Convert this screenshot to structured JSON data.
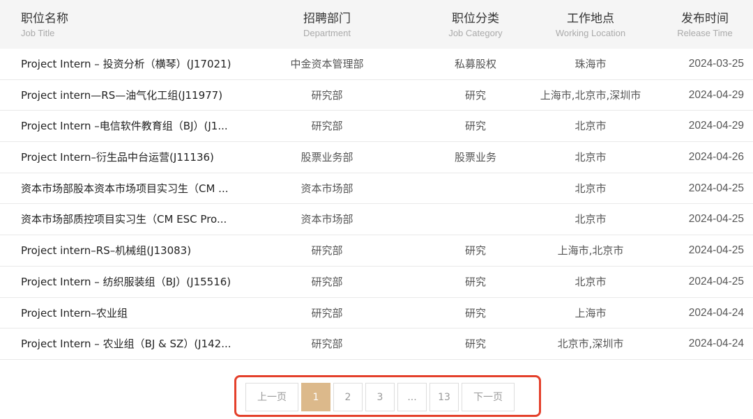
{
  "header": {
    "title": {
      "zh": "职位名称",
      "en": "Job Title"
    },
    "department": {
      "zh": "招聘部门",
      "en": "Department"
    },
    "category": {
      "zh": "职位分类",
      "en": "Job Category"
    },
    "location": {
      "zh": "工作地点",
      "en": "Working Location"
    },
    "release": {
      "zh": "发布时间",
      "en": "Release Time"
    }
  },
  "rows": [
    {
      "title": "Project Intern – 投资分析（横琴）(J17021)",
      "dept": "中金资本管理部",
      "cat": "私募股权",
      "loc": "珠海市",
      "date": "2024-03-25"
    },
    {
      "title": "Project intern—RS—油气化工组(J11977)",
      "dept": "研究部",
      "cat": "研究",
      "loc": "上海市,北京市,深圳市",
      "date": "2024-04-29"
    },
    {
      "title": "Project Intern –电信软件教育组（BJ）(J1...",
      "dept": "研究部",
      "cat": "研究",
      "loc": "北京市",
      "date": "2024-04-29"
    },
    {
      "title": "Project Intern–衍生品中台运营(J11136)",
      "dept": "股票业务部",
      "cat": "股票业务",
      "loc": "北京市",
      "date": "2024-04-26"
    },
    {
      "title": "资本市场部股本资本市场项目实习生（CM ...",
      "dept": "资本市场部",
      "cat": "",
      "loc": "北京市",
      "date": "2024-04-25"
    },
    {
      "title": "资本市场部质控项目实习生（CM ESC Pro...",
      "dept": "资本市场部",
      "cat": "",
      "loc": "北京市",
      "date": "2024-04-25"
    },
    {
      "title": "Project intern–RS–机械组(J13083)",
      "dept": "研究部",
      "cat": "研究",
      "loc": "上海市,北京市",
      "date": "2024-04-25"
    },
    {
      "title": "Project Intern – 纺织服装组（BJ）(J15516)",
      "dept": "研究部",
      "cat": "研究",
      "loc": "北京市",
      "date": "2024-04-25"
    },
    {
      "title": "Project Intern–农业组",
      "dept": "研究部",
      "cat": "研究",
      "loc": "上海市",
      "date": "2024-04-24"
    },
    {
      "title": "Project Intern – 农业组（BJ & SZ）(J142...",
      "dept": "研究部",
      "cat": "研究",
      "loc": "北京市,深圳市",
      "date": "2024-04-24"
    }
  ],
  "pagination": {
    "prev": "上一页",
    "pages": [
      "1",
      "2",
      "3",
      "...",
      "13"
    ],
    "current": "1",
    "next": "下一页"
  },
  "colors": {
    "header_bg": "#f5f5f5",
    "active_page": "#dcb98b",
    "highlight_border": "#e4402b"
  }
}
